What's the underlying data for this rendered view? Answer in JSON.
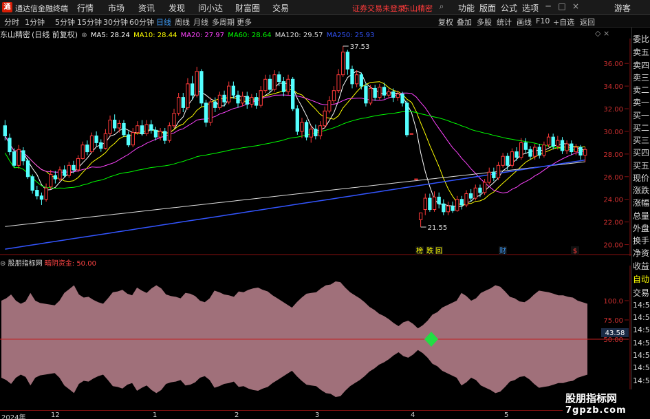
{
  "app": {
    "title": "通达信金融终端",
    "logo_char": "通",
    "menus": [
      "行情",
      "市场",
      "资讯",
      "发现",
      "问小达",
      "财富圈",
      "交易"
    ],
    "login_warning": "证券交易未登录",
    "account": "东山精密",
    "right_menus": [
      "功能",
      "版面",
      "公式",
      "选项"
    ],
    "guest": "游客"
  },
  "toolbar": {
    "periods": [
      "分时",
      "1分钟",
      "5分钟",
      "15分钟",
      "30分钟",
      "60分钟",
      "日线",
      "周线",
      "月线",
      "多周期",
      "更多"
    ],
    "active_period": "日线",
    "buttons": [
      "复权",
      "叠加",
      "多股",
      "统计",
      "画线",
      "F10",
      "+自选",
      "返回"
    ]
  },
  "stock": {
    "name": "东山精密",
    "mode": "(日线 前复权)"
  },
  "ma_legend": [
    {
      "label": "MA5: 28.24",
      "color": "#ffffff"
    },
    {
      "label": "MA10: 28.44",
      "color": "#ffff00"
    },
    {
      "label": "MA20: 27.97",
      "color": "#ff44ff"
    },
    {
      "label": "MA60: 28.64",
      "color": "#00ff00"
    },
    {
      "label": "MA120: 29.57",
      "color": "#dddddd"
    },
    {
      "label": "MA250: 25.93",
      "color": "#3355ff"
    }
  ],
  "chart_data": {
    "type": "candlestick",
    "y_ticks": [
      20.0,
      22.0,
      24.0,
      26.0,
      28.0,
      30.0,
      32.0,
      34.0,
      36.0
    ],
    "ylim": [
      19.0,
      38.2
    ],
    "high_label": "37.53",
    "low_label": "21.55",
    "candles_ohlc": [
      [
        30.5,
        29.6,
        31.0,
        29.2
      ],
      [
        29.4,
        28.2,
        29.8,
        27.9
      ],
      [
        28.2,
        27.0,
        28.5,
        26.8
      ],
      [
        27.0,
        28.4,
        28.8,
        26.7
      ],
      [
        28.3,
        27.4,
        28.6,
        27.0
      ],
      [
        27.4,
        26.0,
        27.6,
        25.8
      ],
      [
        26.0,
        24.8,
        26.2,
        24.5
      ],
      [
        24.8,
        24.3,
        25.2,
        24.0
      ],
      [
        24.3,
        24.0,
        24.6,
        23.5
      ],
      [
        24.0,
        25.0,
        25.4,
        23.8
      ],
      [
        25.1,
        26.2,
        26.6,
        24.9
      ],
      [
        26.1,
        25.8,
        26.5,
        25.4
      ],
      [
        25.8,
        26.6,
        26.9,
        25.6
      ],
      [
        26.6,
        26.1,
        27.0,
        25.9
      ],
      [
        26.1,
        27.0,
        27.3,
        25.9
      ],
      [
        27.0,
        26.6,
        27.4,
        26.3
      ],
      [
        26.6,
        27.6,
        27.9,
        26.4
      ],
      [
        27.6,
        28.8,
        29.1,
        27.5
      ],
      [
        28.8,
        28.2,
        29.2,
        27.9
      ],
      [
        28.2,
        29.6,
        29.9,
        28.1
      ],
      [
        29.6,
        29.0,
        30.0,
        28.7
      ],
      [
        29.0,
        28.5,
        29.3,
        28.2
      ],
      [
        28.5,
        29.8,
        30.2,
        28.4
      ],
      [
        29.8,
        31.0,
        31.4,
        29.6
      ],
      [
        31.0,
        30.3,
        31.5,
        30.0
      ],
      [
        30.3,
        30.7,
        31.0,
        29.9
      ],
      [
        30.7,
        29.7,
        31.0,
        29.5
      ],
      [
        29.7,
        28.8,
        30.0,
        28.6
      ],
      [
        28.8,
        29.9,
        30.3,
        28.6
      ],
      [
        29.9,
        30.5,
        30.9,
        29.7
      ],
      [
        30.5,
        29.8,
        31.0,
        29.6
      ],
      [
        29.8,
        30.6,
        31.0,
        29.6
      ],
      [
        30.6,
        30.1,
        31.0,
        29.8
      ],
      [
        30.1,
        29.5,
        30.4,
        29.2
      ],
      [
        29.5,
        30.0,
        30.3,
        29.2
      ],
      [
        30.0,
        29.2,
        30.3,
        28.9
      ],
      [
        29.2,
        30.5,
        30.8,
        29.0
      ],
      [
        30.5,
        31.6,
        32.0,
        30.3
      ],
      [
        31.6,
        33.0,
        33.4,
        31.4
      ],
      [
        33.0,
        32.1,
        33.4,
        31.7
      ],
      [
        32.1,
        34.2,
        34.7,
        31.9
      ],
      [
        34.2,
        33.2,
        34.9,
        32.8
      ],
      [
        33.2,
        35.3,
        35.7,
        33.0
      ],
      [
        35.3,
        32.5,
        35.5,
        32.2
      ],
      [
        32.5,
        30.8,
        32.8,
        30.4
      ],
      [
        30.8,
        32.6,
        33.0,
        30.5
      ],
      [
        32.6,
        32.1,
        33.0,
        31.7
      ],
      [
        32.1,
        33.2,
        33.5,
        31.9
      ],
      [
        33.2,
        32.6,
        33.6,
        32.2
      ],
      [
        32.6,
        34.0,
        34.4,
        32.4
      ],
      [
        34.0,
        33.2,
        34.4,
        32.9
      ],
      [
        33.2,
        32.5,
        33.6,
        32.1
      ],
      [
        32.5,
        33.1,
        33.5,
        32.2
      ],
      [
        33.1,
        32.4,
        33.5,
        32.0
      ],
      [
        32.4,
        33.0,
        33.3,
        32.1
      ],
      [
        33.0,
        32.3,
        33.4,
        32.0
      ],
      [
        32.3,
        33.6,
        34.0,
        32.1
      ],
      [
        33.6,
        34.6,
        35.0,
        33.4
      ],
      [
        34.6,
        33.7,
        35.0,
        33.4
      ],
      [
        33.7,
        35.0,
        35.4,
        33.5
      ],
      [
        35.0,
        34.4,
        35.3,
        34.0
      ],
      [
        34.4,
        33.5,
        34.8,
        33.1
      ],
      [
        33.5,
        34.6,
        35.0,
        33.2
      ],
      [
        34.6,
        32.0,
        34.8,
        31.8
      ],
      [
        32.0,
        30.0,
        32.3,
        29.7
      ],
      [
        30.0,
        30.8,
        31.2,
        29.4
      ],
      [
        30.8,
        29.5,
        31.0,
        29.2
      ],
      [
        29.5,
        30.2,
        30.5,
        29.0
      ],
      [
        30.2,
        29.6,
        30.6,
        29.3
      ],
      [
        29.6,
        30.5,
        30.9,
        29.3
      ],
      [
        30.5,
        31.8,
        32.2,
        30.3
      ],
      [
        31.8,
        32.7,
        33.1,
        31.6
      ],
      [
        32.7,
        33.6,
        34.0,
        32.4
      ],
      [
        33.6,
        35.0,
        35.5,
        33.4
      ],
      [
        35.0,
        37.0,
        37.53,
        34.8
      ],
      [
        37.0,
        35.5,
        37.2,
        35.0
      ],
      [
        35.5,
        34.2,
        35.8,
        33.8
      ],
      [
        34.2,
        35.0,
        35.4,
        33.9
      ],
      [
        35.0,
        34.0,
        35.2,
        33.7
      ],
      [
        34.0,
        32.5,
        34.3,
        32.2
      ],
      [
        32.5,
        33.8,
        34.1,
        32.3
      ],
      [
        33.8,
        33.0,
        34.1,
        32.7
      ],
      [
        33.0,
        33.9,
        34.2,
        32.8
      ],
      [
        33.9,
        33.2,
        34.3,
        32.9
      ],
      [
        33.2,
        33.5,
        33.8,
        32.9
      ],
      [
        33.5,
        33.0,
        33.8,
        32.6
      ],
      [
        33.0,
        33.3,
        33.6,
        32.7
      ],
      [
        33.3,
        32.5,
        33.5,
        32.2
      ],
      [
        32.5,
        29.7,
        32.7,
        29.5
      ],
      [
        29.8,
        29.8,
        29.8,
        29.8
      ],
      [
        25.8,
        25.8,
        25.8,
        25.8
      ],
      [
        22.2,
        22.8,
        22.6,
        21.55
      ],
      [
        23.1,
        24.1,
        24.5,
        22.6
      ],
      [
        24.1,
        23.1,
        24.5,
        22.9
      ],
      [
        23.1,
        24.2,
        24.7,
        22.9
      ],
      [
        24.2,
        23.6,
        24.6,
        23.2
      ],
      [
        23.6,
        22.9,
        24.0,
        22.6
      ],
      [
        22.9,
        23.4,
        23.8,
        22.6
      ],
      [
        23.4,
        23.0,
        23.8,
        22.8
      ],
      [
        23.0,
        24.0,
        24.3,
        22.9
      ],
      [
        24.0,
        23.5,
        24.3,
        23.1
      ],
      [
        23.5,
        24.5,
        24.8,
        23.3
      ],
      [
        24.5,
        24.1,
        24.9,
        23.8
      ],
      [
        24.1,
        25.0,
        25.3,
        23.9
      ],
      [
        25.0,
        24.6,
        25.3,
        24.2
      ],
      [
        24.6,
        25.5,
        25.8,
        24.4
      ],
      [
        25.5,
        26.4,
        26.8,
        25.3
      ],
      [
        26.4,
        25.9,
        26.8,
        25.6
      ],
      [
        25.9,
        27.0,
        27.3,
        25.7
      ],
      [
        27.0,
        27.8,
        28.1,
        26.8
      ],
      [
        27.8,
        27.0,
        28.1,
        26.6
      ],
      [
        27.0,
        28.2,
        28.5,
        26.8
      ],
      [
        28.2,
        27.7,
        28.6,
        27.4
      ],
      [
        27.7,
        29.0,
        29.4,
        27.5
      ],
      [
        29.0,
        28.4,
        29.4,
        28.1
      ],
      [
        28.4,
        27.8,
        28.7,
        27.5
      ],
      [
        27.8,
        28.6,
        28.9,
        27.5
      ],
      [
        28.6,
        27.9,
        28.9,
        27.6
      ],
      [
        27.9,
        28.8,
        29.1,
        27.7
      ],
      [
        28.8,
        29.5,
        29.8,
        28.6
      ],
      [
        29.5,
        28.7,
        29.8,
        28.4
      ],
      [
        28.7,
        29.2,
        29.6,
        28.4
      ],
      [
        29.2,
        28.3,
        29.5,
        28.0
      ],
      [
        28.3,
        28.9,
        29.2,
        28.0
      ],
      [
        28.9,
        28.2,
        29.2,
        27.9
      ],
      [
        28.2,
        28.6,
        28.9,
        27.9
      ],
      [
        28.6,
        27.9,
        28.8,
        27.5
      ],
      [
        27.9,
        28.4,
        28.6,
        27.3
      ]
    ],
    "ma_color_keys": [
      "#ffffff",
      "#ffff00",
      "#ff44ff",
      "#00ff00",
      "#dddddd",
      "#3355ff"
    ],
    "event_markers": [
      {
        "text": "榜",
        "color": "#ffff00"
      },
      {
        "text": "跌",
        "color": "#ffff00"
      },
      {
        "text": "回",
        "color": "#ffff00"
      },
      {
        "text": "财",
        "color": "#3fa0ff"
      },
      {
        "text": "$",
        "color": "#ff3b3b"
      }
    ],
    "indicator": {
      "name": "股朋指标网",
      "series_label": "暗阴资金: 50.00",
      "y_ticks": [
        50.0,
        75.0,
        100.0
      ],
      "current_value": "43.58",
      "fill_color": "#a0707a",
      "upper": [
        100,
        103,
        108,
        100,
        96,
        99,
        110,
        100,
        97,
        96,
        95,
        94,
        100,
        110,
        115,
        120,
        108,
        104,
        105,
        101,
        98,
        96,
        103,
        111,
        112,
        114,
        109,
        107,
        117,
        113,
        110,
        116,
        120,
        116,
        108,
        106,
        105,
        103,
        110,
        109,
        106,
        100,
        98,
        103,
        113,
        111,
        108,
        107,
        105,
        112,
        111,
        114,
        116,
        117,
        114,
        112,
        107,
        103,
        99,
        95,
        91,
        98,
        104,
        109,
        110,
        111,
        116,
        120,
        121,
        125,
        124,
        117,
        111,
        107,
        103,
        98,
        92,
        88,
        83,
        80,
        76,
        71,
        67,
        72,
        74,
        70,
        64,
        68,
        74,
        82,
        85,
        91,
        94,
        97,
        100,
        110,
        106,
        100,
        103,
        110,
        113,
        116,
        120,
        118,
        112,
        105,
        103,
        99,
        98,
        102,
        108,
        113,
        112,
        111,
        109,
        107,
        107,
        105,
        104,
        100,
        98,
        96
      ],
      "lower": []
    },
    "x_labels": [
      "2024年",
      "12",
      "1",
      "2",
      "3",
      "4",
      "5"
    ]
  },
  "subchart_watermark": {
    "line1": "股朋指标网",
    "line2": "7gpzb.com"
  },
  "right_panel": {
    "top_label": "R\n500",
    "items": [
      "委比",
      "卖五",
      "卖四",
      "卖三",
      "卖二",
      "卖一",
      "买一",
      "买二",
      "买三",
      "买四",
      "买五",
      "现价",
      "涨跌",
      "涨幅",
      "总量",
      "外盘",
      "换手",
      "净资",
      "收益",
      "自动",
      "交易",
      "14:56",
      "14:56",
      "14:56",
      "14:56",
      "14:56",
      "14:56",
      "14:56",
      "14:56"
    ]
  }
}
